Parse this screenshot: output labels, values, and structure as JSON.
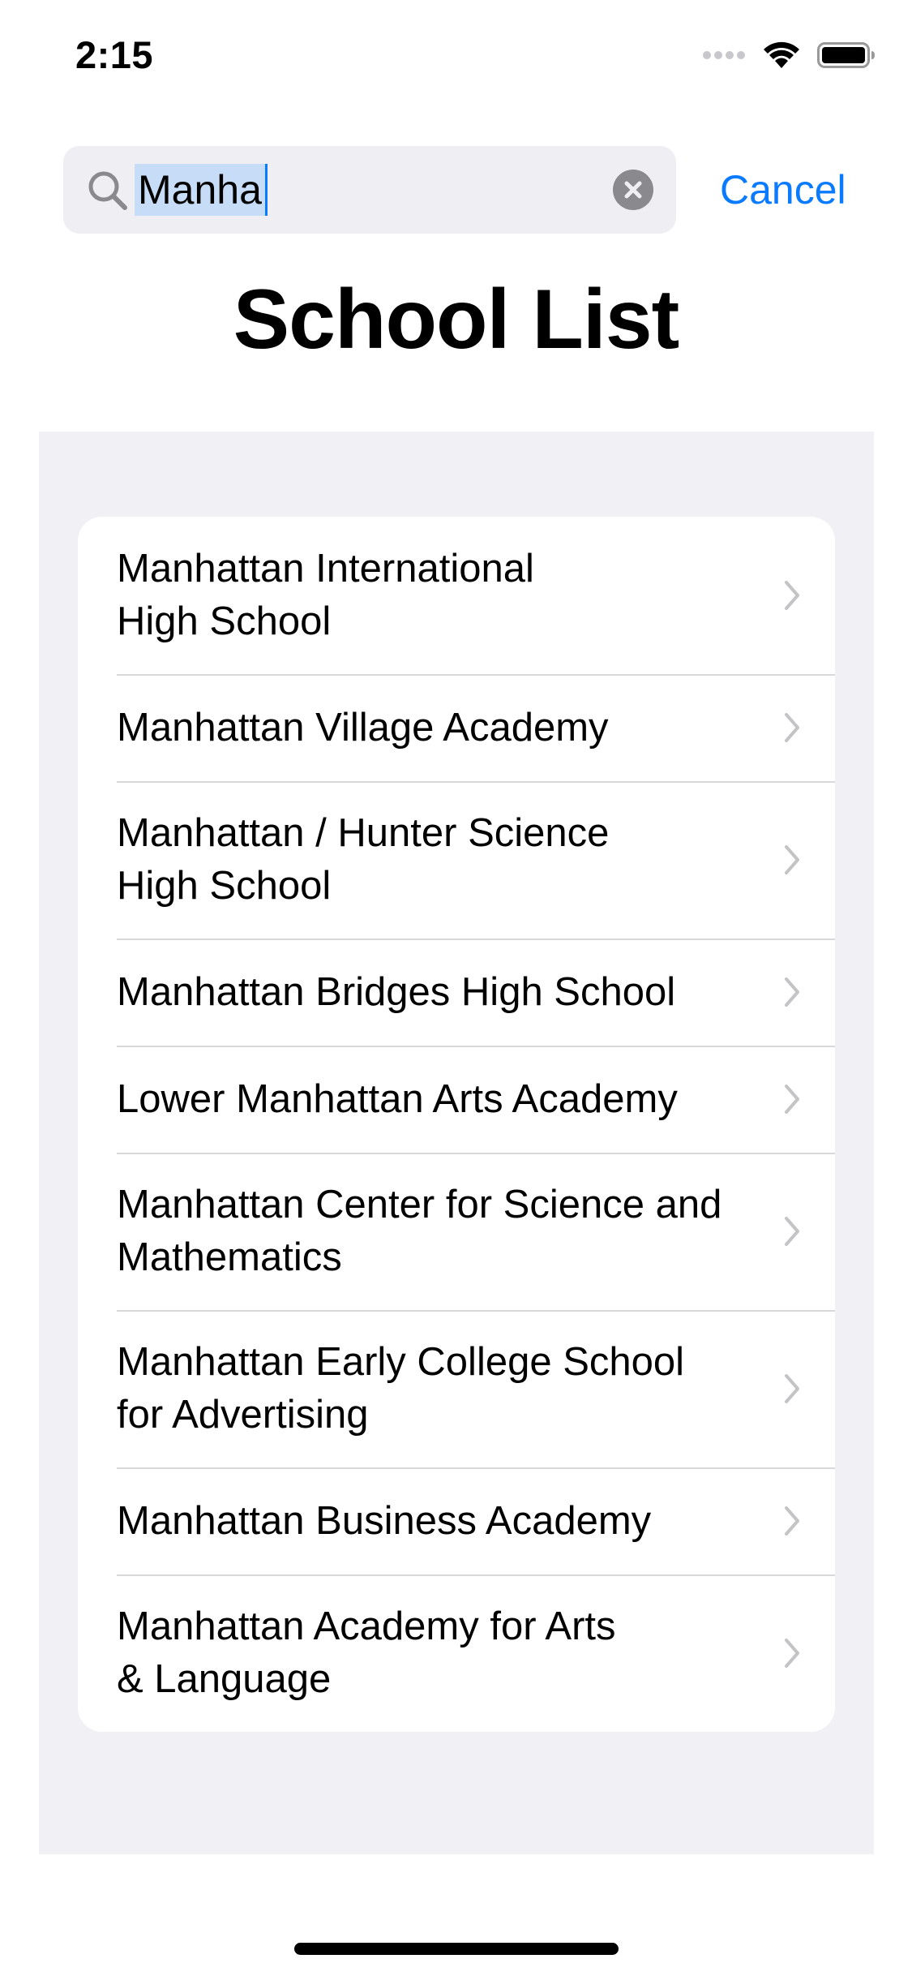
{
  "status_bar": {
    "time": "2:15",
    "icons": [
      "cellular-signal-icon",
      "wifi-icon",
      "battery-icon"
    ]
  },
  "search": {
    "value": "Manha",
    "clear_icon": "clear-icon",
    "cancel_label": "Cancel"
  },
  "title": "School List",
  "colors": {
    "accent": "#0a7aff",
    "list_background": "#f0f0f5",
    "search_field": "#eeeef3",
    "selection": "#c7dcf7"
  },
  "schools": [
    {
      "line1": "Manhattan International",
      "line2": "High School"
    },
    {
      "line1": "Manhattan Village Academy",
      "line2": ""
    },
    {
      "line1": "Manhattan / Hunter Science",
      "line2": "High School"
    },
    {
      "line1": "Manhattan Bridges High School",
      "line2": ""
    },
    {
      "line1": "Lower Manhattan Arts Academy",
      "line2": ""
    },
    {
      "line1": "Manhattan Center for Science and",
      "line2": "Mathematics"
    },
    {
      "line1": "Manhattan Early College School",
      "line2": "for Advertising"
    },
    {
      "line1": "Manhattan Business Academy",
      "line2": ""
    },
    {
      "line1": "Manhattan Academy for Arts",
      "line2": "& Language"
    }
  ]
}
